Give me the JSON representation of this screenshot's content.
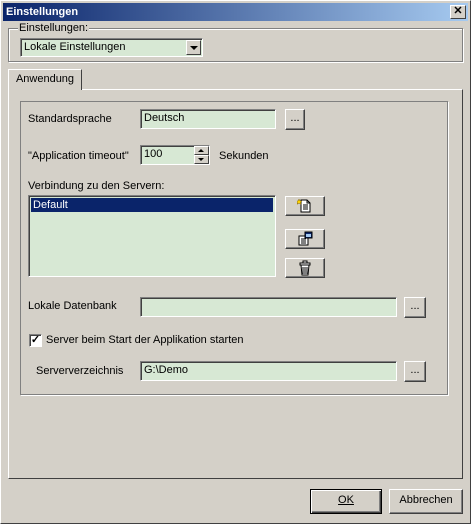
{
  "window": {
    "title": "Einstellungen",
    "close_glyph": "✕"
  },
  "settings_group": {
    "legend": "Einstellungen:",
    "selected": "Lokale Einstellungen"
  },
  "tabs": [
    {
      "label": "Anwendung"
    }
  ],
  "app": {
    "language_label": "Standardsprache",
    "language_value": "Deutsch",
    "browse_label": "...",
    "timeout_label": "\"Application timeout\"",
    "timeout_value": "100",
    "timeout_unit": "Sekunden",
    "servers_label": "Verbindung zu den Servern:",
    "servers": [
      "Default"
    ],
    "local_db_label": "Lokale Datenbank",
    "local_db_value": "",
    "start_server_label": "Server beim Start der Applikation starten",
    "start_server_checked": true,
    "server_dir_label": "Serververzeichnis",
    "server_dir_value": "G:\\Demo"
  },
  "icons": {
    "add_server": "new-document-icon",
    "edit_server": "properties-icon",
    "delete_server": "trash-icon"
  },
  "footer": {
    "ok_label": "OK",
    "cancel_label": "Abbrechen"
  },
  "colors": {
    "field_bg": "#d7e8d4",
    "title_bar": "#0a246a",
    "selection": "#0a246a"
  }
}
